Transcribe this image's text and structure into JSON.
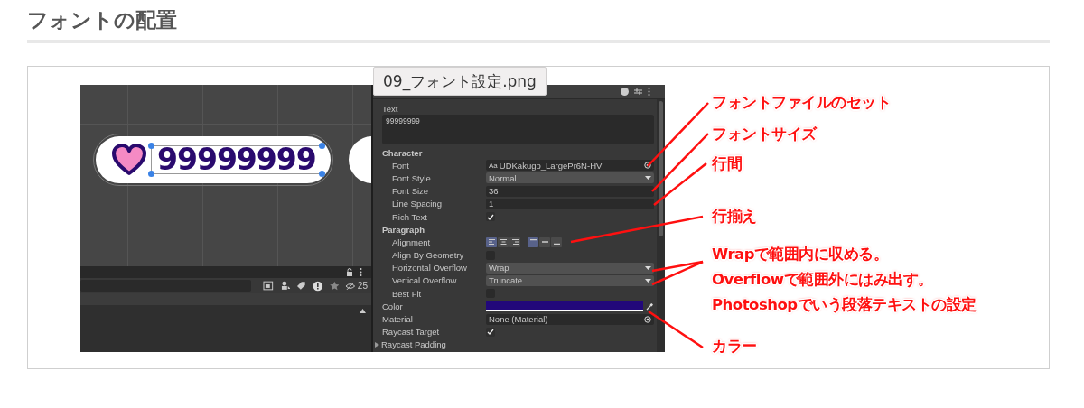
{
  "heading": "フォントの配置",
  "figure": {
    "tooltip": "09_フォント設定.png",
    "scene": {
      "counter_text": "99999999"
    },
    "console": {
      "count": "25"
    },
    "inspector": {
      "text_label": "Text",
      "text_value": "99999999",
      "rows": [
        {
          "kind": "section",
          "label": "Character",
          "children": [
            {
              "kind": "object",
              "label": "Font",
              "prefix": "Aa",
              "value": "UDKakugo_LargePr6N-HV"
            },
            {
              "kind": "dropdown",
              "label": "Font Style",
              "value": "Normal"
            },
            {
              "kind": "field",
              "label": "Font Size",
              "value": "36"
            },
            {
              "kind": "field",
              "label": "Line Spacing",
              "value": "1"
            },
            {
              "kind": "checkbox",
              "label": "Rich Text",
              "checked": true
            }
          ]
        },
        {
          "kind": "section",
          "label": "Paragraph",
          "children": [
            {
              "kind": "alignment",
              "label": "Alignment",
              "horizontal": [
                {
                  "selected": true
                },
                {
                  "selected": false
                },
                {
                  "selected": false
                }
              ],
              "vertical": [
                {
                  "selected": true
                },
                {
                  "selected": false
                },
                {
                  "selected": false
                }
              ]
            },
            {
              "kind": "checkbox",
              "label": "Align By Geometry",
              "checked": false
            },
            {
              "kind": "dropdown",
              "label": "Horizontal Overflow",
              "value": "Wrap"
            },
            {
              "kind": "dropdown",
              "label": "Vertical Overflow",
              "value": "Truncate"
            },
            {
              "kind": "checkbox",
              "label": "Best Fit",
              "checked": false
            }
          ]
        },
        {
          "kind": "color",
          "label": "Color",
          "color": "#22087a"
        },
        {
          "kind": "object",
          "label": "Material",
          "value": "None (Material)"
        },
        {
          "kind": "checkbox",
          "label": "Raycast Target",
          "checked": true
        },
        {
          "kind": "foldout",
          "label": "Raycast Padding",
          "expanded": false
        }
      ]
    },
    "annotations": [
      {
        "lines": [
          "フォントファイルのセット"
        ]
      },
      {
        "lines": [
          "フォントサイズ"
        ]
      },
      {
        "lines": [
          "行間"
        ]
      },
      {
        "lines": [
          "行揃え"
        ]
      },
      {
        "lines": [
          "Wrapで範囲内に収める。",
          "Overflowで範囲外にはみ出す。",
          "Photoshopでいう段落テキストの設定"
        ]
      },
      {
        "lines": [
          "カラー"
        ]
      }
    ]
  }
}
